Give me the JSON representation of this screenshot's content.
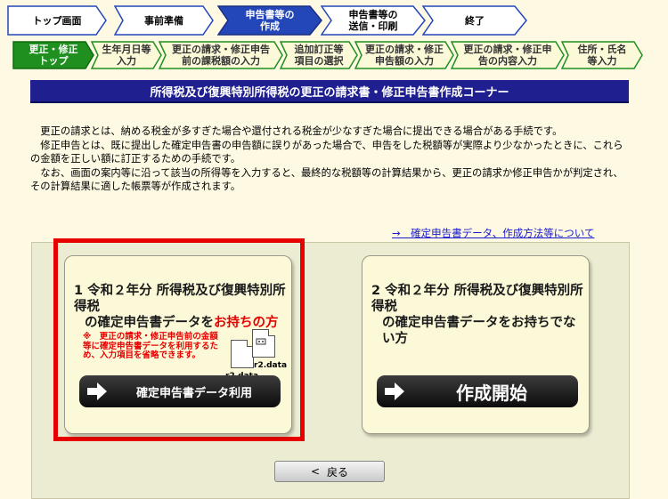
{
  "steps": [
    {
      "label": "トップ画面",
      "active": false
    },
    {
      "label": "事前準備",
      "active": false
    },
    {
      "label": "申告書等の\n作成",
      "active": true
    },
    {
      "label": "申告書等の\n送信・印刷",
      "active": false
    },
    {
      "label": "終了",
      "active": false
    }
  ],
  "substeps": [
    {
      "label": "更正・修正\nトップ",
      "active": true
    },
    {
      "label": "生年月日等\n入力",
      "active": false
    },
    {
      "label": "更正の請求・修正申告\n前の課税額の入力",
      "active": false
    },
    {
      "label": "追加訂正等\n項目の選択",
      "active": false
    },
    {
      "label": "更正の請求・修正\n申告額の入力",
      "active": false
    },
    {
      "label": "更正の請求・修正申\n告の内容入力",
      "active": false
    },
    {
      "label": "住所・氏名\n等入力",
      "active": false
    }
  ],
  "banner": "所得税及び復興特別所得税の更正の請求書・修正申告書作成コーナー",
  "intro": [
    "更正の請求とは、納める税金が多すぎた場合や還付される税金が少なすぎた場合に提出できる場合がある手続です。",
    "修正申告とは、既に提出した確定申告書の申告額に誤りがあった場合で、申告をした税額等が実際より少なかったときに、これらの金額を正しい額に訂正するための手続です。",
    "なお、画面の案内等に沿って該当の所得等を入力すると、最終的な税額等の計算結果から、更正の請求か修正申告かが判定され、その計算結果に適した帳票等が作成されます。"
  ],
  "doc_link": "→　確定申告書データ、作成方法等について",
  "option1": {
    "line1": "1 令和２年分 所得税及び復興特別所得税",
    "line2_prefix": "の確定申告書データを",
    "line2_highlight": "お持ちの方",
    "note": "※　更正の請求・修正申告前の金額等に確定申告書データを利用するため、入力項目を省略できます。",
    "file_a": "r2.data",
    "file_b": "r2.data",
    "button": "確定申告書データ利用"
  },
  "option2": {
    "line1": "2 令和２年分 所得税及び復興特別所得税",
    "line2": "の確定申告書データをお持ちでない方",
    "button": "作成開始"
  },
  "back_button": {
    "arrow": "<",
    "label": "戻る"
  },
  "colors": {
    "accent_red": "#e60000",
    "banner_blue": "#1f1f8f",
    "active_step": "#2346b8",
    "active_sub": "#1f8f1f",
    "link": "#1a1acf"
  }
}
